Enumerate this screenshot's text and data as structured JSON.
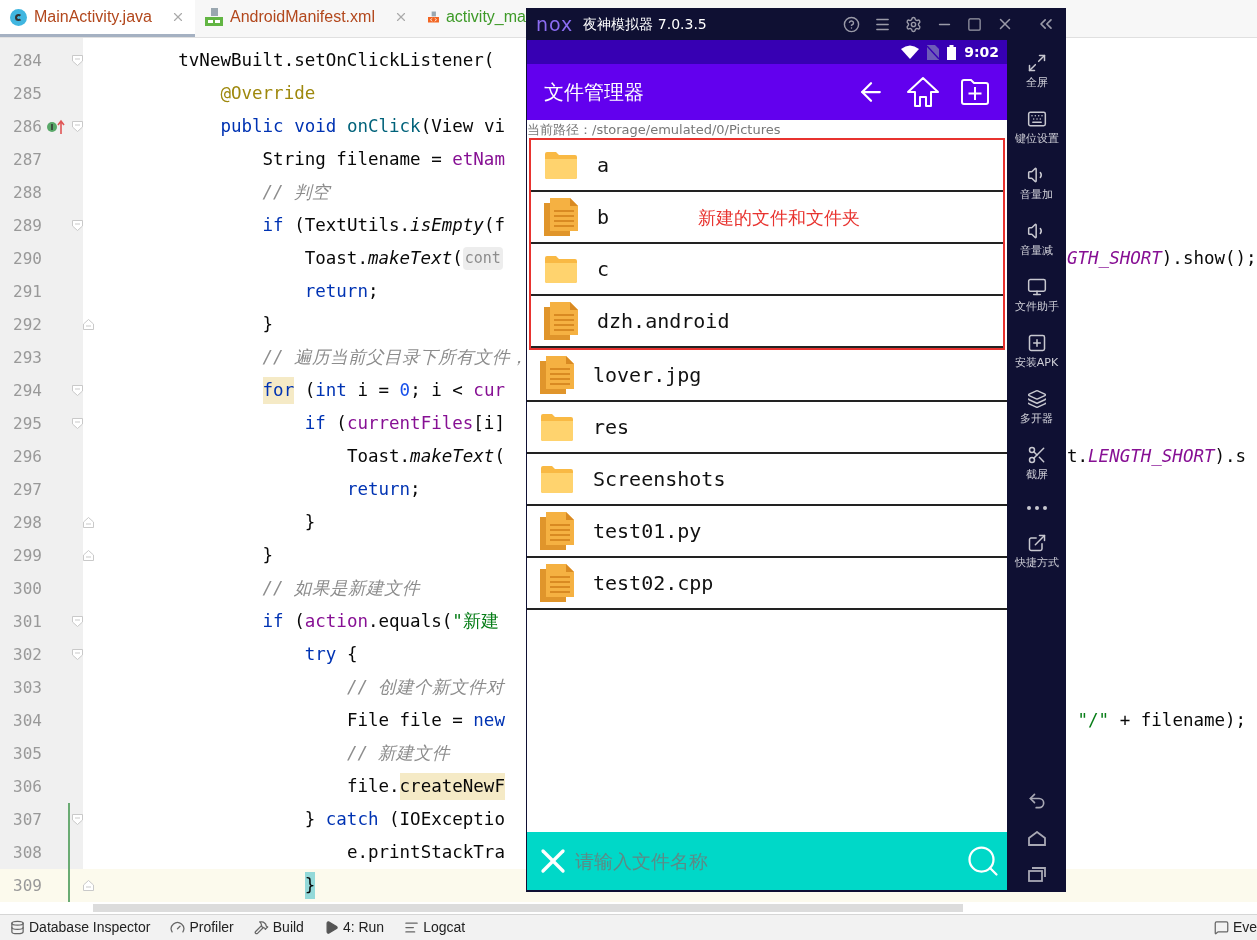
{
  "editor": {
    "tabs": [
      {
        "label": "MainActivity.java",
        "kind": "java",
        "selected": true,
        "closable": true
      },
      {
        "label": "AndroidManifest.xml",
        "kind": "manifest",
        "selected": false,
        "closable": true
      },
      {
        "label": "activity_ma",
        "kind": "layout",
        "selected": false,
        "closable": false
      }
    ],
    "lines": [
      {
        "no": "284",
        "fold_start": true,
        "fold_end": false,
        "implements": false,
        "changed": false,
        "current": false,
        "code": [
          {
            "text": "        tvNewBuilt.setOnClickListener(",
            "kind": "plain"
          }
        ]
      },
      {
        "no": "285",
        "fold_start": false,
        "fold_end": false,
        "implements": false,
        "changed": false,
        "current": false,
        "code": [
          {
            "text": "            @Override",
            "kind": "annotation"
          }
        ]
      },
      {
        "no": "286",
        "fold_start": true,
        "fold_end": false,
        "implements": true,
        "changed": false,
        "current": false,
        "code": [
          {
            "text": "            public",
            "kind": "keyword"
          },
          {
            "text": " void",
            "kind": "keyword"
          },
          {
            "text": " onClick",
            "kind": "decl"
          },
          {
            "text": "(View vi",
            "kind": "plain"
          }
        ]
      },
      {
        "no": "287",
        "fold_start": false,
        "fold_end": false,
        "implements": false,
        "changed": false,
        "current": false,
        "code": [
          {
            "text": "                String filename = ",
            "kind": "plain"
          },
          {
            "text": "etNam",
            "kind": "field"
          }
        ]
      },
      {
        "no": "288",
        "fold_start": false,
        "fold_end": false,
        "implements": false,
        "changed": false,
        "current": false,
        "code": [
          {
            "text": "                // 判空",
            "kind": "comment"
          }
        ]
      },
      {
        "no": "289",
        "fold_start": true,
        "fold_end": false,
        "implements": false,
        "changed": false,
        "current": false,
        "code": [
          {
            "text": "                if",
            "kind": "keyword"
          },
          {
            "text": " (TextUtils.",
            "kind": "plain"
          },
          {
            "text": "isEmpty",
            "kind": "italic"
          },
          {
            "text": "(f",
            "kind": "plain"
          }
        ]
      },
      {
        "no": "290",
        "fold_start": false,
        "fold_end": false,
        "implements": false,
        "changed": false,
        "current": false,
        "code": [
          {
            "text": "                    Toast.",
            "kind": "plain"
          },
          {
            "text": "makeText",
            "kind": "italic"
          },
          {
            "text": "(",
            "kind": "plain"
          },
          {
            "text": "cont",
            "kind": "hint"
          }
        ],
        "right": [
          {
            "text": "GTH_SHORT",
            "kind": "field_italic"
          },
          {
            "text": ").show();",
            "kind": "plain"
          }
        ]
      },
      {
        "no": "291",
        "fold_start": false,
        "fold_end": false,
        "implements": false,
        "changed": false,
        "current": false,
        "code": [
          {
            "text": "                    return",
            "kind": "keyword"
          },
          {
            "text": ";",
            "kind": "plain"
          }
        ]
      },
      {
        "no": "292",
        "fold_start": false,
        "fold_end": true,
        "implements": false,
        "changed": false,
        "current": false,
        "code": [
          {
            "text": "                }",
            "kind": "plain"
          }
        ]
      },
      {
        "no": "293",
        "fold_start": false,
        "fold_end": false,
        "implements": false,
        "changed": false,
        "current": false,
        "code": [
          {
            "text": "                // 遍历当前父目录下所有文件，",
            "kind": "comment"
          }
        ]
      },
      {
        "no": "294",
        "fold_start": true,
        "fold_end": false,
        "implements": false,
        "changed": false,
        "current": false,
        "code": [
          {
            "text": "                for",
            "kind": "keyword_hl"
          },
          {
            "text": " (",
            "kind": "plain"
          },
          {
            "text": "int",
            "kind": "keyword"
          },
          {
            "text": " i = ",
            "kind": "plain"
          },
          {
            "text": "0",
            "kind": "number"
          },
          {
            "text": "; i < ",
            "kind": "plain"
          },
          {
            "text": "cur",
            "kind": "field"
          }
        ]
      },
      {
        "no": "295",
        "fold_start": true,
        "fold_end": false,
        "implements": false,
        "changed": false,
        "current": false,
        "code": [
          {
            "text": "                    if",
            "kind": "keyword"
          },
          {
            "text": " (",
            "kind": "plain"
          },
          {
            "text": "currentFiles",
            "kind": "field"
          },
          {
            "text": "[i]",
            "kind": "plain"
          }
        ]
      },
      {
        "no": "296",
        "fold_start": false,
        "fold_end": false,
        "implements": false,
        "changed": false,
        "current": false,
        "code": [
          {
            "text": "                        Toast.",
            "kind": "plain"
          },
          {
            "text": "makeText",
            "kind": "italic"
          },
          {
            "text": "(",
            "kind": "plain"
          }
        ],
        "right": [
          {
            "text": "t.",
            "kind": "plain"
          },
          {
            "text": "LENGTH_SHORT",
            "kind": "field_italic"
          },
          {
            "text": ").s",
            "kind": "plain"
          }
        ]
      },
      {
        "no": "297",
        "fold_start": false,
        "fold_end": false,
        "implements": false,
        "changed": false,
        "current": false,
        "code": [
          {
            "text": "                        return",
            "kind": "keyword"
          },
          {
            "text": ";",
            "kind": "plain"
          }
        ]
      },
      {
        "no": "298",
        "fold_start": false,
        "fold_end": true,
        "implements": false,
        "changed": false,
        "current": false,
        "code": [
          {
            "text": "                    }",
            "kind": "plain"
          }
        ]
      },
      {
        "no": "299",
        "fold_start": false,
        "fold_end": true,
        "implements": false,
        "changed": false,
        "current": false,
        "code": [
          {
            "text": "                }",
            "kind": "plain"
          }
        ]
      },
      {
        "no": "300",
        "fold_start": false,
        "fold_end": false,
        "implements": false,
        "changed": false,
        "current": false,
        "code": [
          {
            "text": "                // 如果是新建文件",
            "kind": "comment"
          }
        ]
      },
      {
        "no": "301",
        "fold_start": true,
        "fold_end": false,
        "implements": false,
        "changed": false,
        "current": false,
        "code": [
          {
            "text": "                if",
            "kind": "keyword"
          },
          {
            "text": " (",
            "kind": "plain"
          },
          {
            "text": "action",
            "kind": "field"
          },
          {
            "text": ".equals(",
            "kind": "plain"
          },
          {
            "text": "\"新建",
            "kind": "string"
          }
        ]
      },
      {
        "no": "302",
        "fold_start": true,
        "fold_end": false,
        "implements": false,
        "changed": false,
        "current": false,
        "code": [
          {
            "text": "                    try",
            "kind": "keyword"
          },
          {
            "text": " {",
            "kind": "plain"
          }
        ]
      },
      {
        "no": "303",
        "fold_start": false,
        "fold_end": false,
        "implements": false,
        "changed": false,
        "current": false,
        "code": [
          {
            "text": "                        // 创建个新文件对",
            "kind": "comment"
          }
        ]
      },
      {
        "no": "304",
        "fold_start": false,
        "fold_end": false,
        "implements": false,
        "changed": false,
        "current": false,
        "code": [
          {
            "text": "                        File file = ",
            "kind": "plain"
          },
          {
            "text": "new",
            "kind": "keyword"
          }
        ],
        "right": [
          {
            "text": " \"/\"",
            "kind": "string"
          },
          {
            "text": " + filename);",
            "kind": "plain"
          }
        ]
      },
      {
        "no": "305",
        "fold_start": false,
        "fold_end": false,
        "implements": false,
        "changed": false,
        "current": false,
        "code": [
          {
            "text": "                        // 新建文件",
            "kind": "comment"
          }
        ]
      },
      {
        "no": "306",
        "fold_start": false,
        "fold_end": false,
        "implements": false,
        "changed": false,
        "current": false,
        "code": [
          {
            "text": "                        file.",
            "kind": "plain"
          },
          {
            "text": "createNewF",
            "kind": "call_hl"
          }
        ]
      },
      {
        "no": "307",
        "fold_start": true,
        "fold_end": false,
        "implements": false,
        "changed": true,
        "current": false,
        "code": [
          {
            "text": "                    } ",
            "kind": "plain"
          },
          {
            "text": "catch",
            "kind": "keyword"
          },
          {
            "text": " (IOExceptio",
            "kind": "plain"
          }
        ]
      },
      {
        "no": "308",
        "fold_start": false,
        "fold_end": false,
        "implements": false,
        "changed": true,
        "current": false,
        "code": [
          {
            "text": "                        e.printStackTra",
            "kind": "plain"
          }
        ]
      },
      {
        "no": "309",
        "fold_start": false,
        "fold_end": true,
        "implements": false,
        "changed": true,
        "current": true,
        "code": [
          {
            "text": "                    }",
            "kind": "brace_hl"
          }
        ]
      }
    ]
  },
  "tool_windows": [
    {
      "label": "Database Inspector",
      "kind": "database"
    },
    {
      "label": "Profiler",
      "kind": "profiler"
    },
    {
      "label": "Build",
      "kind": "build"
    },
    {
      "label": "4: Run",
      "kind": "run"
    },
    {
      "label": "Logcat",
      "kind": "logcat"
    },
    {
      "label": "Eve",
      "kind": "event"
    }
  ],
  "emulator": {
    "logo": "nox",
    "title": "夜神模拟器 7.0.3.5",
    "status_bar": {
      "time": "9:02"
    },
    "app": {
      "title": "文件管理器",
      "path": "当前路径：/storage/emulated/0/Pictures",
      "annotation": "新建的文件和文件夹",
      "files": [
        {
          "name": "a",
          "kind": "folder",
          "new": true
        },
        {
          "name": "b",
          "kind": "file",
          "new": true
        },
        {
          "name": "c",
          "kind": "folder",
          "new": true
        },
        {
          "name": "dzh.android",
          "kind": "file",
          "new": true
        },
        {
          "name": "lover.jpg",
          "kind": "file",
          "new": false
        },
        {
          "name": "res",
          "kind": "folder",
          "new": false
        },
        {
          "name": "Screenshots",
          "kind": "folder",
          "new": false
        },
        {
          "name": "test01.py",
          "kind": "file",
          "new": false
        },
        {
          "name": "test02.cpp",
          "kind": "file",
          "new": false
        }
      ],
      "search": {
        "placeholder": "请输入文件名称"
      }
    },
    "sidebar": [
      {
        "kind": "fullscreen",
        "label": "全屏"
      },
      {
        "kind": "keyboard",
        "label": "键位设置"
      },
      {
        "kind": "volume_up",
        "label": "音量加"
      },
      {
        "kind": "volume_down",
        "label": "音量减"
      },
      {
        "kind": "files",
        "label": "文件助手"
      },
      {
        "kind": "apk",
        "label": "安装APK"
      },
      {
        "kind": "multi",
        "label": "多开器"
      },
      {
        "kind": "screenshot",
        "label": "截屏"
      },
      {
        "kind": "more"
      },
      {
        "kind": "shortcut",
        "label": "快捷方式"
      }
    ]
  }
}
